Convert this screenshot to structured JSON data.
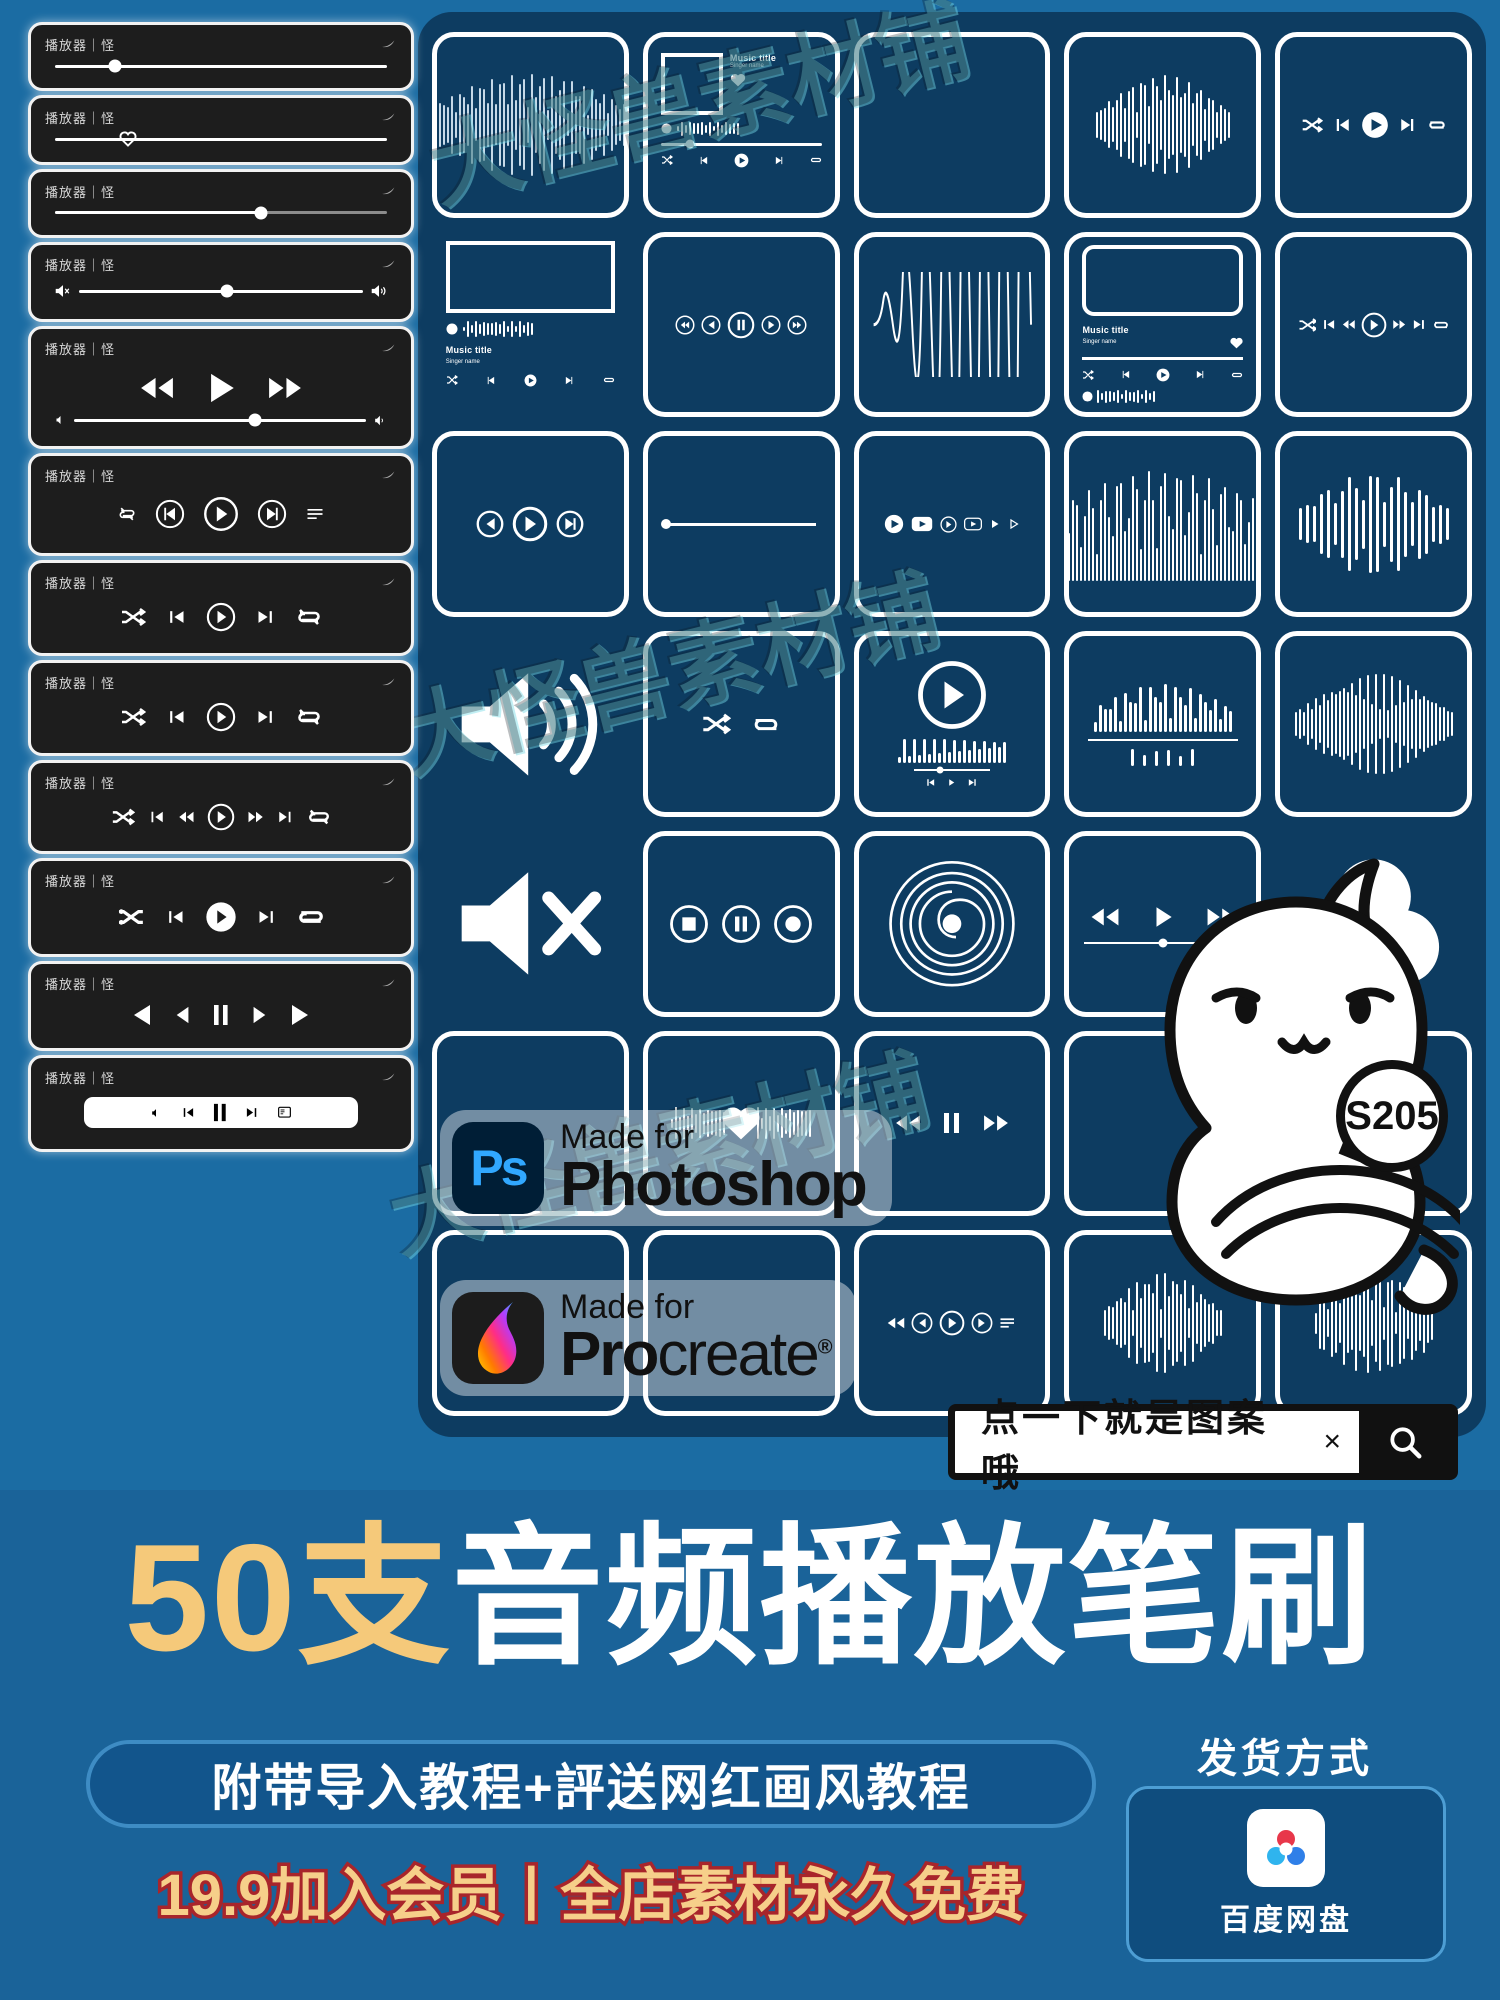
{
  "theme": {
    "bg_blue": "#1a6399",
    "panel_navy": "#0d3c61",
    "amber": "#f5c97a",
    "red_stroke": "#a8252b",
    "white": "#ffffff",
    "dark_panel": "#1d1d1d"
  },
  "players": {
    "label": "播放器｜怪",
    "items": [
      {
        "id": "p1",
        "kind": "slider",
        "knob_pct": 18
      },
      {
        "id": "p2",
        "kind": "slider-heart",
        "knob_pct": 22
      },
      {
        "id": "p3",
        "kind": "slider",
        "knob_pct": 62
      },
      {
        "id": "p4",
        "kind": "volume-slider",
        "knob_pct": 52
      },
      {
        "id": "p5",
        "kind": "transport-big",
        "knob_pct": 62
      },
      {
        "id": "p6",
        "kind": "circle-row-1"
      },
      {
        "id": "p7",
        "kind": "circle-row-2"
      },
      {
        "id": "p8",
        "kind": "circle-row-3"
      },
      {
        "id": "p9",
        "kind": "circle-row-4"
      },
      {
        "id": "p10",
        "kind": "circle-row-5"
      },
      {
        "id": "p11",
        "kind": "triangle-row"
      },
      {
        "id": "p12",
        "kind": "pill-bar"
      }
    ]
  },
  "grid": {
    "music_card": {
      "title": "Music title",
      "subtitle": "Singer name"
    },
    "cells": [
      {
        "r": 1,
        "c": 1,
        "type": "waveform-soft"
      },
      {
        "r": 1,
        "c": 2,
        "type": "music-card"
      },
      {
        "r": 1,
        "c": 3,
        "type": "empty"
      },
      {
        "r": 1,
        "c": 4,
        "type": "waveform-lines"
      },
      {
        "r": 1,
        "c": 5,
        "type": "transport-filled"
      },
      {
        "r": 2,
        "c": 1,
        "type": "music-card-sm"
      },
      {
        "r": 2,
        "c": 2,
        "type": "transport-circles"
      },
      {
        "r": 2,
        "c": 3,
        "type": "waveform-sine"
      },
      {
        "r": 2,
        "c": 4,
        "type": "music-card-tall"
      },
      {
        "r": 2,
        "c": 5,
        "type": "transport-outline"
      },
      {
        "r": 3,
        "c": 1,
        "type": "transport-circles-2"
      },
      {
        "r": 3,
        "c": 2,
        "type": "dot-line"
      },
      {
        "r": 3,
        "c": 3,
        "type": "play-row-small"
      },
      {
        "r": 3,
        "c": 4,
        "type": "waveform-dense"
      },
      {
        "r": 3,
        "c": 5,
        "type": "waveform-bars"
      },
      {
        "r": 4,
        "c": 1,
        "type": "speaker-on"
      },
      {
        "r": 4,
        "c": 2,
        "type": "shuffle-repeat"
      },
      {
        "r": 4,
        "c": 3,
        "type": "record-play"
      },
      {
        "r": 4,
        "c": 4,
        "type": "eq-bars"
      },
      {
        "r": 4,
        "c": 5,
        "type": "waveform-mirror"
      },
      {
        "r": 5,
        "c": 1,
        "type": "speaker-mute"
      },
      {
        "r": 5,
        "c": 2,
        "type": "stop-pause-rec"
      },
      {
        "r": 5,
        "c": 3,
        "type": "vinyl-spiral"
      },
      {
        "r": 5,
        "c": 4,
        "type": "transport-slider"
      },
      {
        "r": 5,
        "c": 5,
        "type": "clover-heart"
      },
      {
        "r": 6,
        "c": 1,
        "type": "empty"
      },
      {
        "r": 6,
        "c": 2,
        "type": "waveform-heart"
      },
      {
        "r": 6,
        "c": 3,
        "type": "transport-plain"
      },
      {
        "r": 6,
        "c": 4,
        "type": "empty"
      },
      {
        "r": 6,
        "c": 5,
        "type": "empty"
      },
      {
        "r": 7,
        "c": 1,
        "type": "empty"
      },
      {
        "r": 7,
        "c": 2,
        "type": "empty"
      },
      {
        "r": 7,
        "c": 3,
        "type": "transport-outline-2"
      },
      {
        "r": 7,
        "c": 4,
        "type": "waveform-long"
      },
      {
        "r": 7,
        "c": 5,
        "type": "waveform-tail"
      }
    ]
  },
  "badges": {
    "photoshop": {
      "made_for": "Made for",
      "app": "Photoshop",
      "icon_text": "Ps"
    },
    "procreate": {
      "made_for": "Made for",
      "app_bold": "Pro",
      "app_light": "create",
      "reg": "®"
    }
  },
  "watermark": {
    "text": "大怪兽素材铺"
  },
  "mascot": {
    "bubble_text": "S205"
  },
  "search_bar": {
    "text": "点一下就是图案哦",
    "clear_icon": "×",
    "search_icon": "search-icon"
  },
  "bottom": {
    "headline_prefix": "50支",
    "headline_main": "音频播放笔刷",
    "sub_pill": "附带导入教程+評送网红画风教程",
    "price_line": "19.9加入会员丨全店素材永久免费",
    "delivery_title": "发货方式",
    "delivery_name": "百度网盘"
  }
}
